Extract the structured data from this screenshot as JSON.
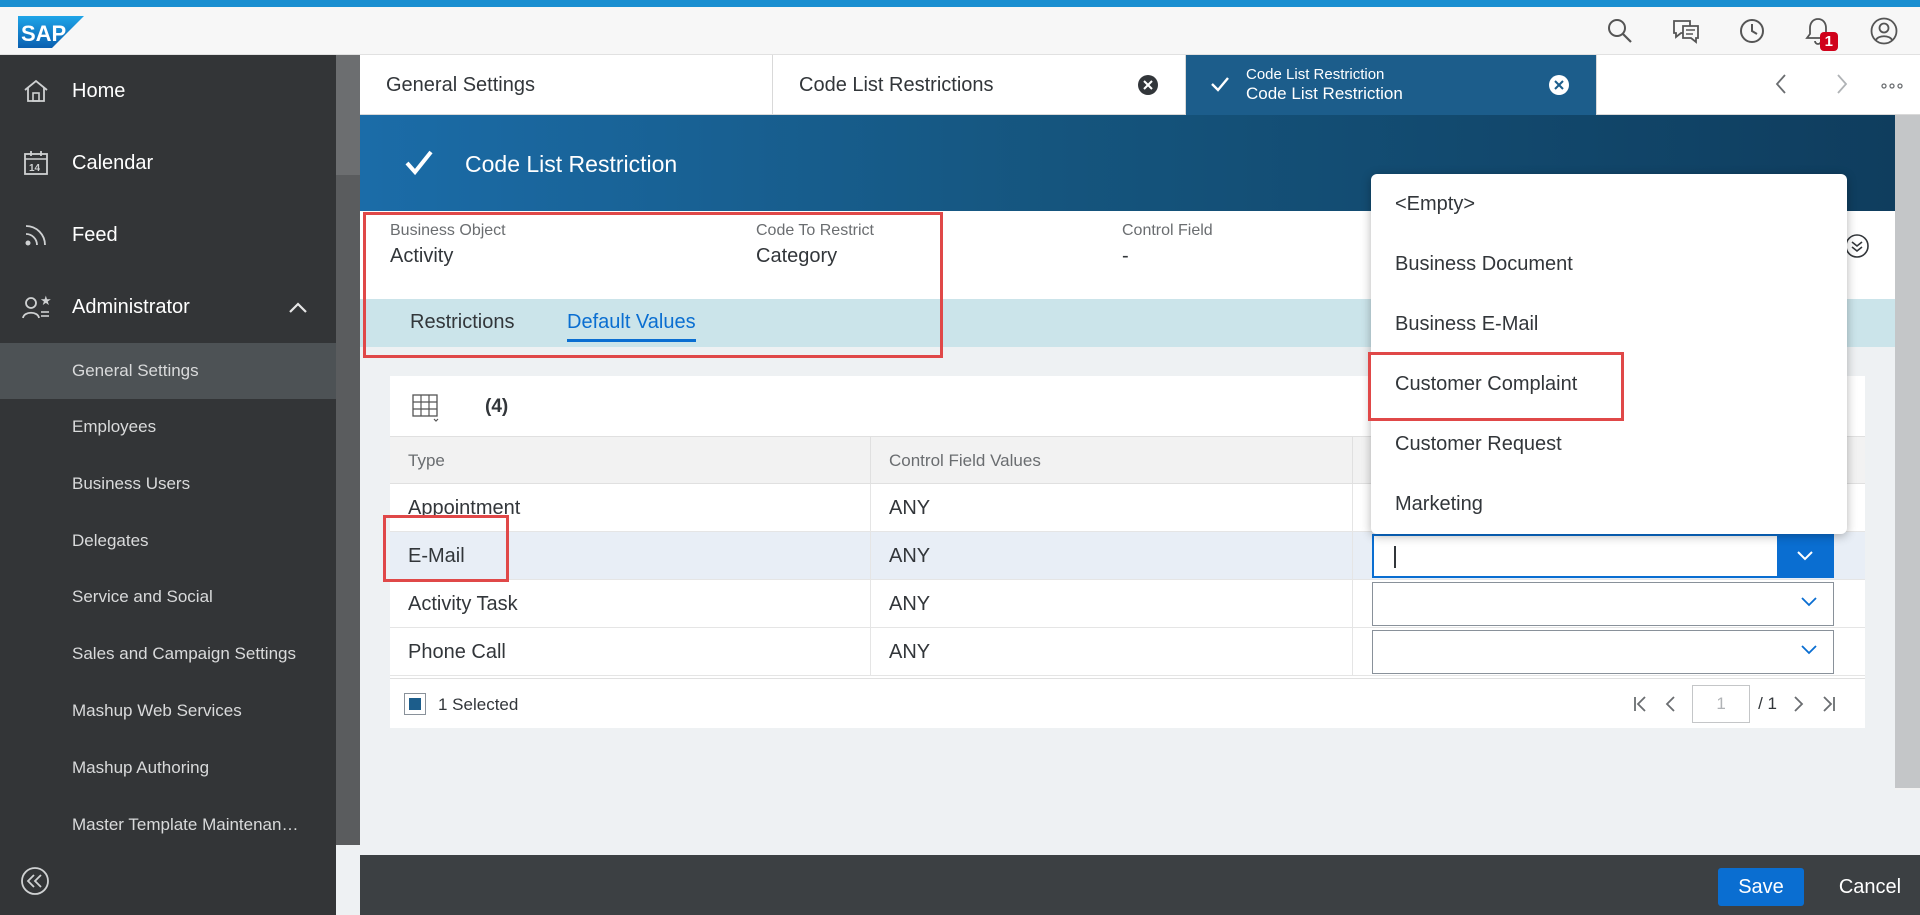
{
  "shell": {
    "logo_text": "SAP",
    "notification_count": "1",
    "icons": [
      "search-icon",
      "chat-icon",
      "history-icon",
      "bell-icon",
      "user-icon"
    ],
    "accent": "#1a8fd1"
  },
  "sidebar": {
    "main_items": [
      {
        "label": "Home",
        "icon": "home-icon"
      },
      {
        "label": "Calendar",
        "icon": "calendar-icon",
        "icon_text": "14"
      },
      {
        "label": "Feed",
        "icon": "feed-icon"
      },
      {
        "label": "Administrator",
        "icon": "administrator-icon",
        "expanded": true
      }
    ],
    "sub_items": [
      {
        "label": "General Settings",
        "active": true
      },
      {
        "label": "Employees"
      },
      {
        "label": "Business Users"
      },
      {
        "label": "Delegates"
      },
      {
        "label": "Service and Social"
      },
      {
        "label": "Sales and Campaign Settings"
      },
      {
        "label": "Mashup Web Services"
      },
      {
        "label": "Mashup Authoring"
      },
      {
        "label": "Master Template Maintenan…"
      }
    ]
  },
  "tabs": [
    {
      "label": "General Settings",
      "closable": false
    },
    {
      "label": "Code List Restrictions",
      "closable": true
    },
    {
      "sublabel": "Code List Restriction",
      "label": "Code List Restriction",
      "closable": true,
      "active": true
    }
  ],
  "object_header": {
    "title": "Code List Restriction",
    "fields": [
      {
        "label": "Business Object",
        "value": "Activity"
      },
      {
        "label": "Code To Restrict",
        "value": "Category"
      },
      {
        "label": "Control Field",
        "value": "-"
      }
    ]
  },
  "subtabs": [
    {
      "label": "Restrictions",
      "active": false
    },
    {
      "label": "Default Values",
      "active": true
    }
  ],
  "table": {
    "count": "(4)",
    "columns": [
      "Type",
      "Control Field Values"
    ],
    "rows": [
      {
        "type": "Appointment",
        "control": "ANY"
      },
      {
        "type": "E-Mail",
        "control": "ANY",
        "selected": true
      },
      {
        "type": "Activity Task",
        "control": "ANY"
      },
      {
        "type": "Phone Call",
        "control": "ANY"
      }
    ],
    "footer": {
      "selected_text": "1 Selected",
      "page_placeholder": "1",
      "page_total": "/ 1"
    }
  },
  "dropdown": {
    "options": [
      "<Empty>",
      "Business Document",
      "Business E-Mail",
      "Customer Complaint",
      "Customer Request",
      "Marketing"
    ],
    "highlighted": "Customer Complaint"
  },
  "footer": {
    "save_label": "Save",
    "cancel_label": "Cancel"
  },
  "colors": {
    "brand_blue": "#0a6ed1",
    "header_blue": "#1c5d8b",
    "highlight_red": "#e04848",
    "sidebar_bg": "#333537"
  }
}
